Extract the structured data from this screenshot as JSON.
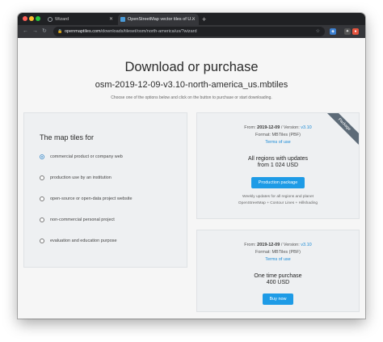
{
  "browser": {
    "tabs": [
      {
        "title": "Wizard",
        "active": false
      },
      {
        "title": "OpenStreetMap vector tiles of U...",
        "active": true
      }
    ],
    "url_domain": "openmaptiles.com",
    "url_path": "/downloads/tileset/osm/north-america/us/?wizard"
  },
  "page": {
    "title": "Download or purchase",
    "subtitle": "osm-2019-12-09-v3.10-north-america_us.mbtiles",
    "instructions": "Choose one of the options below and click on the button to purchase or start downloading."
  },
  "options": {
    "heading": "The map tiles for",
    "items": [
      {
        "label": "commercial product or company web",
        "selected": true
      },
      {
        "label": "production use by an institution",
        "selected": false
      },
      {
        "label": "open-source or open-data project website",
        "selected": false
      },
      {
        "label": "non-commercial personal project",
        "selected": false
      },
      {
        "label": "evaluation and education purpose",
        "selected": false
      }
    ]
  },
  "package_card": {
    "ribbon": "Package",
    "from_label": "From:",
    "date": "2019-12-09",
    "version_label": "/ Version:",
    "version": "v3.10",
    "format_label": "Format:",
    "format": "MBTiles (PBF)",
    "terms": "Terms of use",
    "price_line1": "All regions with updates",
    "price_line2": "from 1 024 USD",
    "button": "Production package",
    "note_line1": "Weekly updates for all regions and planet",
    "note_line2": "OpenStreetMap + Contour Lines + Hillshading"
  },
  "single_card": {
    "from_label": "From:",
    "date": "2019-12-09",
    "version_label": "/ Version:",
    "version": "v3.10",
    "format_label": "Format:",
    "format": "MBTiles (PBF)",
    "terms": "Terms of use",
    "price_line1": "One time purchase",
    "price_line2": "400 USD",
    "button": "Buy now"
  },
  "colors": {
    "accent": "#1e9be6",
    "link": "#1a8ad6",
    "ribbon": "#5d6b78",
    "panel": "#eef0f2"
  }
}
